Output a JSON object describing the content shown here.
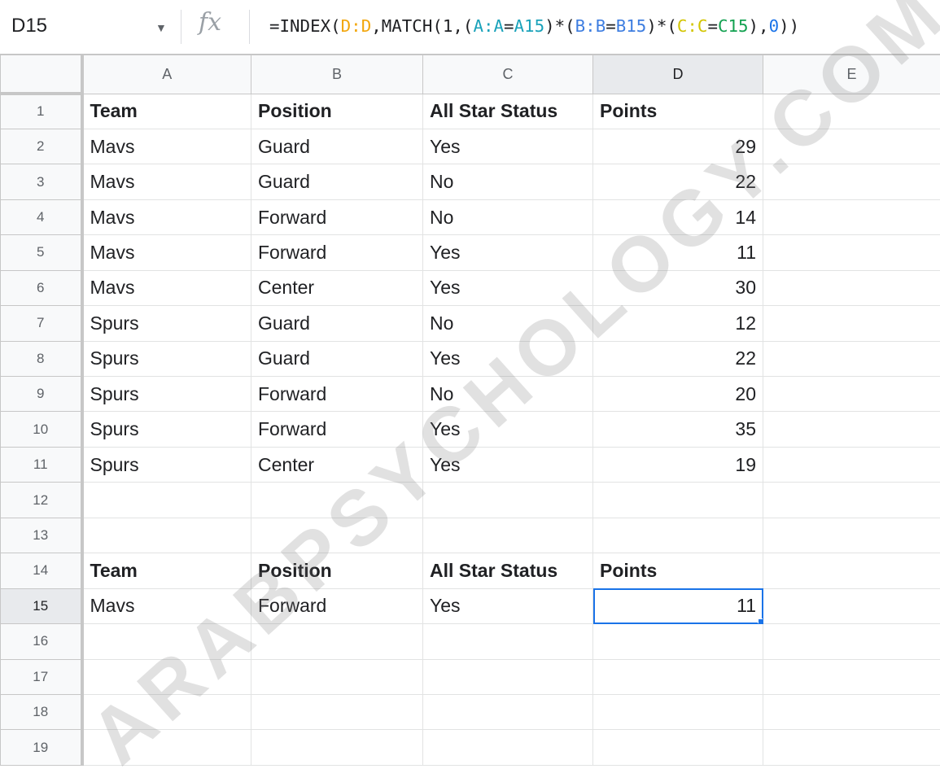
{
  "formula_bar": {
    "cell_ref": "D15",
    "formula_tokens": [
      {
        "text": "=INDEX(",
        "color": "#202124"
      },
      {
        "text": "D:D",
        "color": "#f2a60c"
      },
      {
        "text": ",MATCH(1,(",
        "color": "#202124"
      },
      {
        "text": "A:A",
        "color": "#1aa2ba"
      },
      {
        "text": "=",
        "color": "#202124"
      },
      {
        "text": "A15",
        "color": "#1aa2ba"
      },
      {
        "text": ")*(",
        "color": "#202124"
      },
      {
        "text": "B:B",
        "color": "#3d7de0"
      },
      {
        "text": "=",
        "color": "#202124"
      },
      {
        "text": "B15",
        "color": "#3d7de0"
      },
      {
        "text": ")*(",
        "color": "#202124"
      },
      {
        "text": "C:C",
        "color": "#d3c500"
      },
      {
        "text": "=",
        "color": "#202124"
      },
      {
        "text": "C15",
        "color": "#12a150"
      },
      {
        "text": "),",
        "color": "#202124"
      },
      {
        "text": "0",
        "color": "#1a73e8"
      },
      {
        "text": "))",
        "color": "#202124"
      }
    ]
  },
  "columns": [
    "A",
    "B",
    "C",
    "D",
    "E"
  ],
  "rows": [
    {
      "n": "1",
      "cells": [
        "Team",
        "Position",
        "All Star Status",
        "Points",
        ""
      ],
      "bold": true
    },
    {
      "n": "2",
      "cells": [
        "Mavs",
        "Guard",
        "Yes",
        "29",
        ""
      ]
    },
    {
      "n": "3",
      "cells": [
        "Mavs",
        "Guard",
        "No",
        "22",
        ""
      ]
    },
    {
      "n": "4",
      "cells": [
        "Mavs",
        "Forward",
        "No",
        "14",
        ""
      ]
    },
    {
      "n": "5",
      "cells": [
        "Mavs",
        "Forward",
        "Yes",
        "11",
        ""
      ]
    },
    {
      "n": "6",
      "cells": [
        "Mavs",
        "Center",
        "Yes",
        "30",
        ""
      ]
    },
    {
      "n": "7",
      "cells": [
        "Spurs",
        "Guard",
        "No",
        "12",
        ""
      ]
    },
    {
      "n": "8",
      "cells": [
        "Spurs",
        "Guard",
        "Yes",
        "22",
        ""
      ]
    },
    {
      "n": "9",
      "cells": [
        "Spurs",
        "Forward",
        "No",
        "20",
        ""
      ]
    },
    {
      "n": "10",
      "cells": [
        "Spurs",
        "Forward",
        "Yes",
        "35",
        ""
      ]
    },
    {
      "n": "11",
      "cells": [
        "Spurs",
        "Center",
        "Yes",
        "19",
        ""
      ]
    },
    {
      "n": "12",
      "cells": [
        "",
        "",
        "",
        "",
        ""
      ]
    },
    {
      "n": "13",
      "cells": [
        "",
        "",
        "",
        "",
        ""
      ]
    },
    {
      "n": "14",
      "cells": [
        "Team",
        "Position",
        "All Star Status",
        "Points",
        ""
      ],
      "bold": true
    },
    {
      "n": "15",
      "cells": [
        "Mavs",
        "Forward",
        "Yes",
        "11",
        ""
      ],
      "active": true
    },
    {
      "n": "16",
      "cells": [
        "",
        "",
        "",
        "",
        ""
      ]
    },
    {
      "n": "17",
      "cells": [
        "",
        "",
        "",
        "",
        ""
      ]
    },
    {
      "n": "18",
      "cells": [
        "",
        "",
        "",
        "",
        ""
      ]
    },
    {
      "n": "19",
      "cells": [
        "",
        "",
        "",
        "",
        ""
      ]
    }
  ],
  "watermark": "ARABPSYCHOLOGY.COM"
}
